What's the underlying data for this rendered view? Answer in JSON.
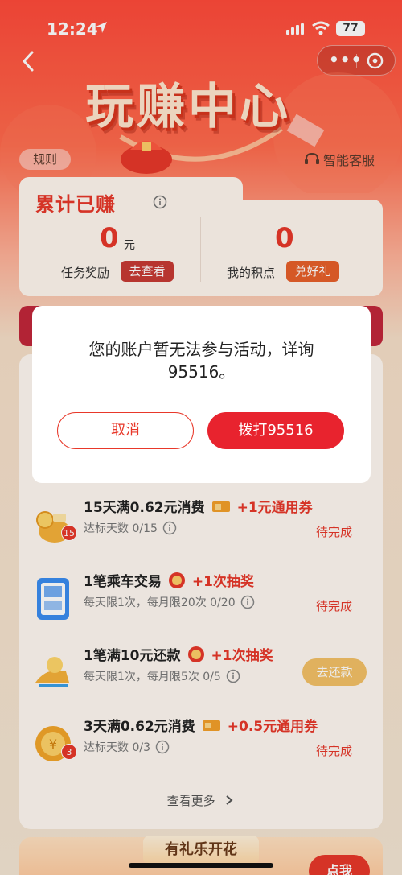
{
  "status_bar": {
    "time": "12:24",
    "battery": "77"
  },
  "header": {
    "title": "玩赚中心",
    "rules": "规则",
    "service": "智能客服",
    "more": "•••"
  },
  "earnings": {
    "title": "累计已赚",
    "reward_value": "0",
    "reward_unit": "元",
    "reward_label": "任务奖励",
    "reward_btn": "去查看",
    "points_value": "0",
    "points_label": "我的积点",
    "points_btn": "兑好礼"
  },
  "tasks": [
    {
      "name": "15天满0.62元消费",
      "reward": "+1元通用券",
      "sub": "达标天数 0/15",
      "badge": "15",
      "state": "待完成"
    },
    {
      "name": "1笔乘车交易",
      "reward": "+1次抽奖",
      "sub": "每天限1次，每月限20次 0/20",
      "state": "待完成"
    },
    {
      "name": "1笔满10元还款",
      "reward": "+1次抽奖",
      "sub": "每天限1次，每月限5次 0/5",
      "button": "去还款"
    },
    {
      "name": "3天满0.62元消费",
      "reward": "+0.5元通用券",
      "sub": "达标天数 0/3",
      "badge": "3",
      "state": "待完成"
    }
  ],
  "see_more": "查看更多",
  "bottom": {
    "title": "有礼乐开花",
    "button": "点我"
  },
  "dialog": {
    "message": "您的账户暂无法参与活动，详询95516。",
    "cancel": "取消",
    "confirm": "拨打95516"
  },
  "colors": {
    "brand_red": "#e8382a",
    "dialog_button": "#e8232e",
    "repay_button": "#f4c167"
  }
}
